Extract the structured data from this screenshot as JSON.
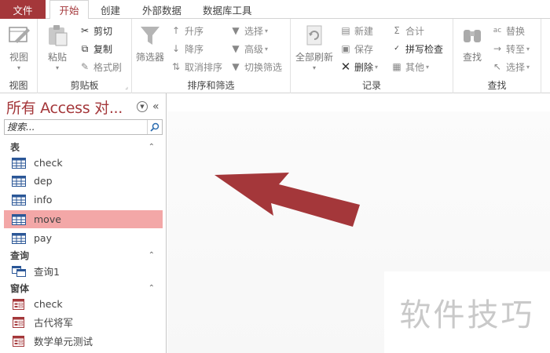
{
  "tabs": {
    "file": "文件",
    "home": "开始",
    "create": "创建",
    "external": "外部数据",
    "dbtools": "数据库工具"
  },
  "ribbon": {
    "view": {
      "button": "视图",
      "group": "视图"
    },
    "clipboard": {
      "paste": "粘贴",
      "cut": "剪切",
      "copy": "复制",
      "format_painter": "格式刷",
      "group": "剪贴板"
    },
    "sort_filter": {
      "filter": "筛选器",
      "ascending": "升序",
      "descending": "降序",
      "remove_sort": "取消排序",
      "selection": "选择",
      "advanced": "高级",
      "toggle_filter": "切换筛选",
      "group": "排序和筛选"
    },
    "records": {
      "refresh_all": "全部刷新",
      "new": "新建",
      "save": "保存",
      "delete": "删除",
      "totals": "合计",
      "spelling": "拼写检查",
      "more": "其他",
      "group": "记录"
    },
    "find": {
      "find": "查找",
      "replace": "替换",
      "goto": "转至",
      "select": "选择",
      "group": "查找"
    }
  },
  "nav": {
    "title": "所有 Access 对...",
    "search_placeholder": "搜索...",
    "categories": [
      {
        "label": "表",
        "items": [
          "check",
          "dep",
          "info",
          "move",
          "pay"
        ]
      },
      {
        "label": "查询",
        "items": [
          "查询1"
        ]
      },
      {
        "label": "窗体",
        "items": [
          "check",
          "古代将军",
          "数学单元测试"
        ]
      }
    ],
    "selected_item": "move"
  },
  "watermark": "软件技巧",
  "colors": {
    "accent": "#a4373a",
    "selection": "#f3a7a7",
    "arrow": "#a4373a"
  },
  "icons": {
    "table": "table-icon",
    "query": "query-icon",
    "form": "form-icon",
    "search": "search-icon"
  }
}
